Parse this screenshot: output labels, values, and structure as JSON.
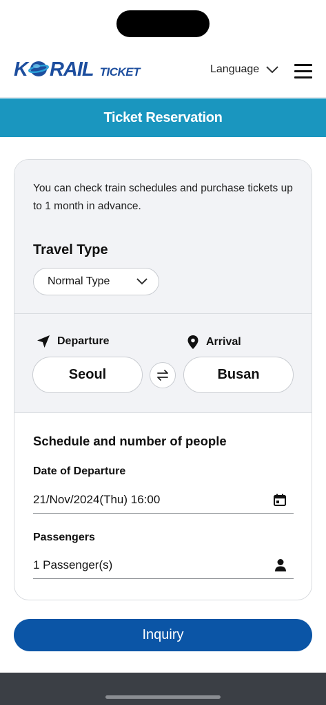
{
  "header": {
    "logo_main": "K",
    "logo_rest": "RAIL",
    "logo_ticket": "TICKET",
    "language_label": "Language",
    "brand_color": "#1d4e9e"
  },
  "banner": {
    "title": "Ticket Reservation",
    "color": "#1a96bf"
  },
  "notice": "You can check train schedules and purchase tickets up to 1 month in advance.",
  "travel_type": {
    "title": "Travel Type",
    "selected": "Normal Type"
  },
  "stations": {
    "departure_label": "Departure",
    "arrival_label": "Arrival",
    "departure_value": "Seoul",
    "arrival_value": "Busan"
  },
  "schedule": {
    "title": "Schedule and number of people",
    "date_label": "Date of Departure",
    "date_value": "21/Nov/2024(Thu) 16:00",
    "passengers_label": "Passengers",
    "passengers_value": "1 Passenger(s)"
  },
  "inquiry_label": "Inquiry",
  "icons": [
    "chevron-down-icon",
    "hamburger-menu-icon",
    "navigation-arrow-icon",
    "map-pin-icon",
    "swap-icon",
    "calendar-icon",
    "person-icon"
  ]
}
